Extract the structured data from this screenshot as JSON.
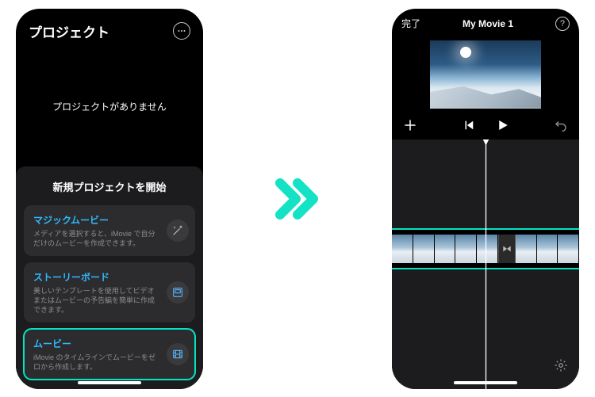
{
  "left": {
    "title": "プロジェクト",
    "empty_message": "プロジェクトがありません",
    "new_section_title": "新規プロジェクトを開始",
    "options": [
      {
        "title": "マジックムービー",
        "desc": "メディアを選択すると、iMovie で自分だけのムービーを作成できます。",
        "icon": "magic-wand-icon"
      },
      {
        "title": "ストーリーボード",
        "desc": "美しいテンプレートを使用してビデオまたはムービーの予告編を簡単に作成できます。",
        "icon": "storyboard-icon"
      },
      {
        "title": "ムービー",
        "desc": "iMovie のタイムラインでムービーをゼロから作成します。",
        "icon": "film-icon"
      }
    ]
  },
  "right": {
    "done_label": "完了",
    "movie_title": "My Movie 1"
  }
}
